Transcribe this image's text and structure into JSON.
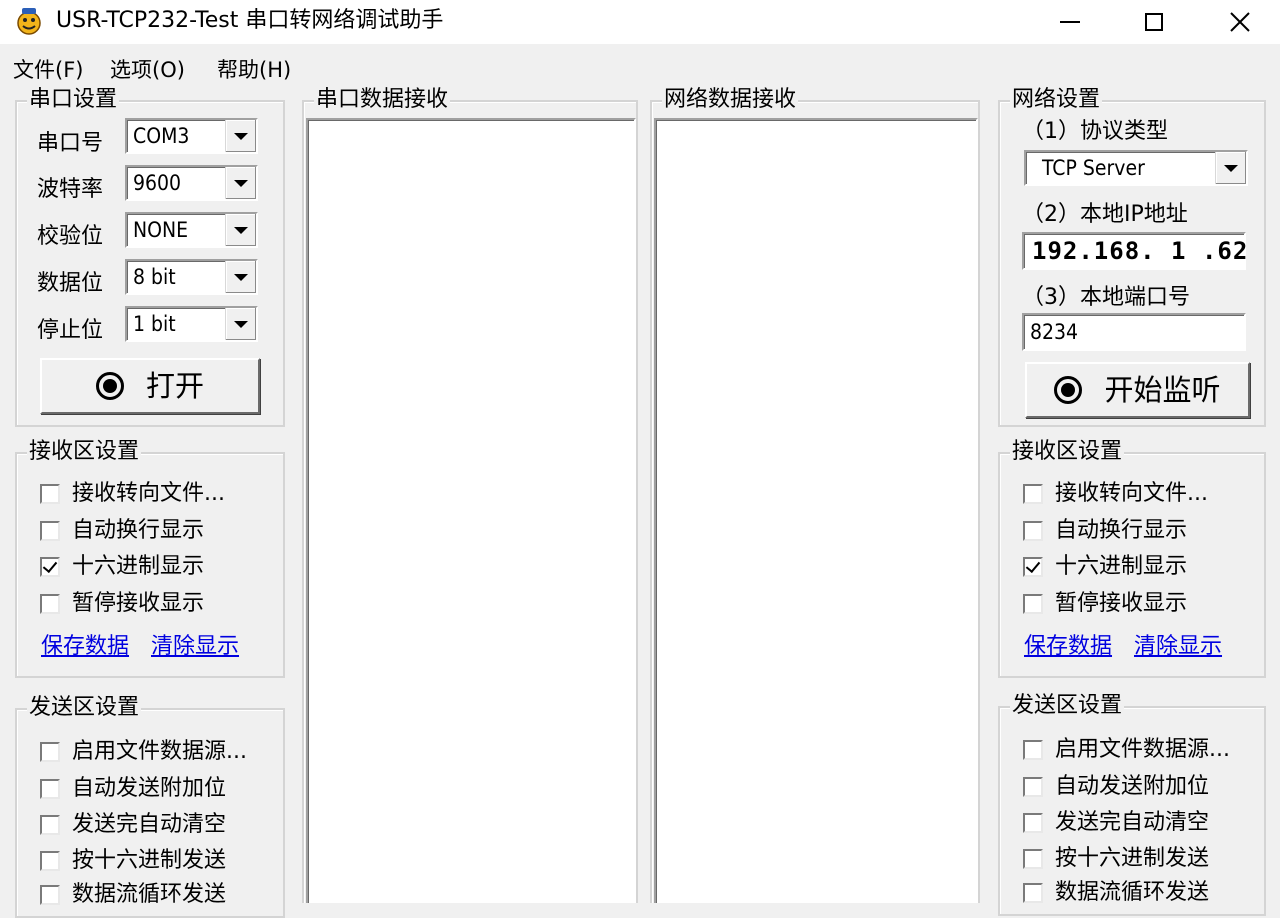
{
  "window": {
    "title": "USR-TCP232-Test 串口转网络调试助手",
    "minimize_glyph": "—",
    "maximize_glyph": "☐",
    "close_glyph": "✕"
  },
  "menu": [
    "文件(F)",
    "选项(O)",
    "帮助(H)"
  ],
  "serial_settings": {
    "title": "串口设置",
    "fields": [
      {
        "label": "串口号",
        "value": "COM3"
      },
      {
        "label": "波特率",
        "value": "9600"
      },
      {
        "label": "校验位",
        "value": "NONE"
      },
      {
        "label": "数据位",
        "value": "8 bit"
      },
      {
        "label": "停止位",
        "value": "1 bit"
      }
    ],
    "open_button": "打开"
  },
  "left_receive": {
    "title": "接收区设置",
    "options": [
      {
        "label": "接收转向文件...",
        "checked": false
      },
      {
        "label": "自动换行显示",
        "checked": false
      },
      {
        "label": "十六进制显示",
        "checked": true
      },
      {
        "label": "暂停接收显示",
        "checked": false
      }
    ],
    "save_link": "保存数据",
    "clear_link": "清除显示"
  },
  "left_send": {
    "title": "发送区设置",
    "options": [
      {
        "label": "启用文件数据源...",
        "checked": false
      },
      {
        "label": "自动发送附加位",
        "checked": false
      },
      {
        "label": "发送完自动清空",
        "checked": false
      },
      {
        "label": "按十六进制发送",
        "checked": false
      },
      {
        "label": "数据流循环发送",
        "checked": false
      }
    ]
  },
  "serial_receive": {
    "title": "串口数据接收",
    "content": ""
  },
  "network_receive": {
    "title": "网络数据接收",
    "content": ""
  },
  "network_settings": {
    "title": "网络设置",
    "protocol_label": "（1）协议类型",
    "protocol_value": "TCP Server",
    "ip_label": "（2）本地IP地址",
    "ip_value": "192.168. 1 .62",
    "port_label": "（3）本地端口号",
    "port_value": "8234",
    "listen_button": "开始监听"
  },
  "right_receive": {
    "title": "接收区设置",
    "options": [
      {
        "label": "接收转向文件...",
        "checked": false
      },
      {
        "label": "自动换行显示",
        "checked": false
      },
      {
        "label": "十六进制显示",
        "checked": true
      },
      {
        "label": "暂停接收显示",
        "checked": false
      }
    ],
    "save_link": "保存数据",
    "clear_link": "清除显示"
  },
  "right_send": {
    "title": "发送区设置",
    "options": [
      {
        "label": "启用文件数据源...",
        "checked": false
      },
      {
        "label": "自动发送附加位",
        "checked": false
      },
      {
        "label": "发送完自动清空",
        "checked": false
      },
      {
        "label": "按十六进制发送",
        "checked": false
      },
      {
        "label": "数据流循环发送",
        "checked": false
      }
    ]
  }
}
